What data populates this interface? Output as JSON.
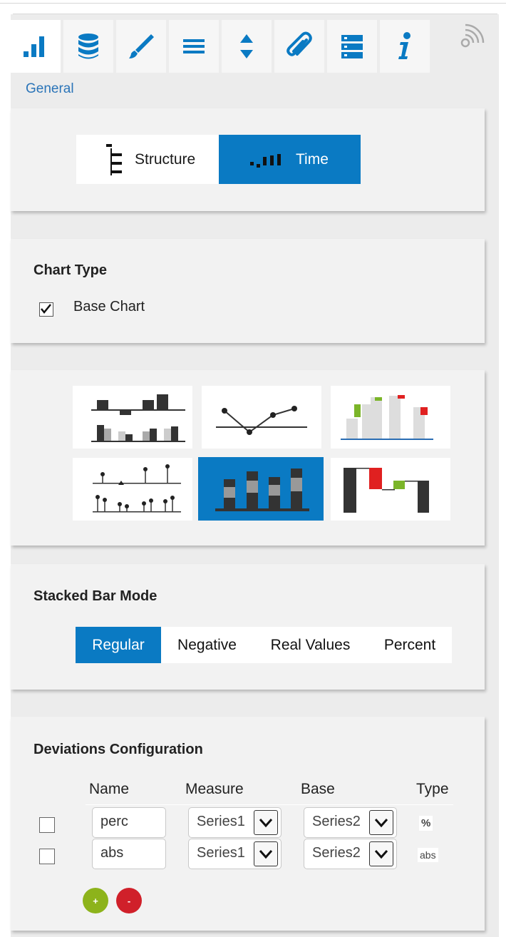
{
  "tabs": [
    {
      "icon": "bar-chart-icon",
      "active": true
    },
    {
      "icon": "database-icon",
      "active": false
    },
    {
      "icon": "brush-icon",
      "active": false
    },
    {
      "icon": "list-icon",
      "active": false
    },
    {
      "icon": "sort-icon",
      "active": false
    },
    {
      "icon": "paperclip-icon",
      "active": false
    },
    {
      "icon": "server-icon",
      "active": false
    },
    {
      "icon": "info-icon",
      "active": false
    }
  ],
  "breadcrumb": "General",
  "axis_type": {
    "options": [
      "Structure",
      "Time"
    ],
    "selected": "Time"
  },
  "chart_type": {
    "title": "Chart Type",
    "base_chart_label": "Base Chart",
    "base_chart_checked": true,
    "tiles": [
      "column-chart",
      "line-chart",
      "waterfall-deviation-chart",
      "pin-chart",
      "stacked-bar-chart",
      "waterfall-chart"
    ],
    "selected_tile": "stacked-bar-chart"
  },
  "stacked_bar_mode": {
    "title": "Stacked Bar Mode",
    "options": [
      "Regular",
      "Negative",
      "Real Values",
      "Percent"
    ],
    "selected": "Regular"
  },
  "deviations": {
    "title": "Deviations Configuration",
    "columns": [
      "Name",
      "Measure",
      "Base",
      "Type"
    ],
    "rows": [
      {
        "name": "perc",
        "measure": "Series1",
        "base": "Series2",
        "type": "%"
      },
      {
        "name": "abs",
        "measure": "Series1",
        "base": "Series2",
        "type": "abs"
      }
    ],
    "add_label": "+",
    "remove_label": "-"
  },
  "colors": {
    "accent": "#0a7ac3",
    "link": "#2a74b8",
    "add": "#8db31b",
    "remove": "#d0202a"
  }
}
